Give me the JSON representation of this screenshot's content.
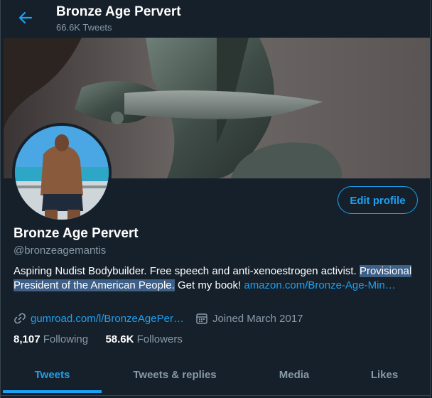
{
  "header": {
    "title": "Bronze Age Pervert",
    "tweet_count": "66.6K Tweets"
  },
  "profile": {
    "edit_label": "Edit profile",
    "name": "Bronze Age Pervert",
    "handle": "@bronzeagemantis",
    "bio_line1": "Aspiring Nudist Bodybuilder. Free speech and anti-xenoestrogen activist.",
    "bio_highlight": "Provisional President of the American People.",
    "bio_text2": " Get my book! ",
    "bio_link": "amazon.com/Bronze-Age-Min…",
    "website": "gumroad.com/l/BronzeAgePer…",
    "joined": "Joined March 2017",
    "following_count": "8,107",
    "following_label": "Following",
    "followers_count": "58.6K",
    "followers_label": "Followers"
  },
  "tabs": [
    {
      "label": "Tweets",
      "active": true
    },
    {
      "label": "Tweets & replies",
      "active": false
    },
    {
      "label": "Media",
      "active": false
    },
    {
      "label": "Likes",
      "active": false
    }
  ],
  "colors": {
    "background": "#15202b",
    "accent": "#1da1f2",
    "secondary_text": "#8899a6",
    "highlight": "#3e5f86"
  },
  "icons": {
    "back": "arrow-left-icon",
    "link": "link-icon",
    "calendar": "calendar-icon"
  }
}
